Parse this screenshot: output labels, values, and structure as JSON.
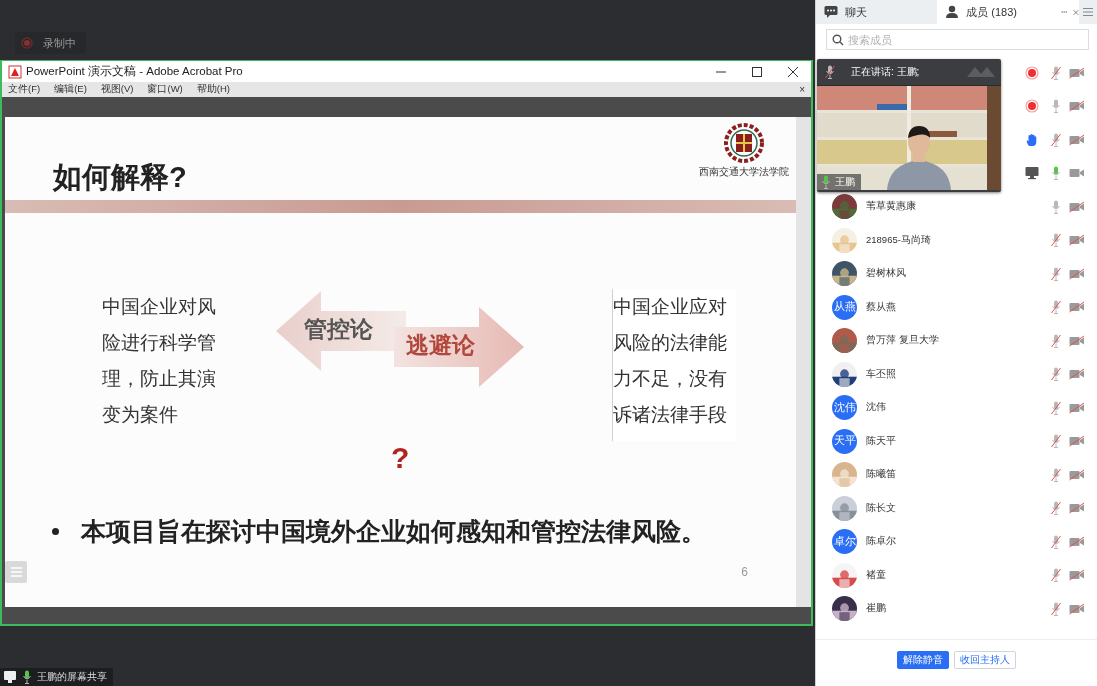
{
  "recording_badge": {
    "label": "录制中"
  },
  "shared_window": {
    "title": "PowerPoint 演示文稿 - Adobe Acrobat Pro",
    "menu": [
      "文件(F)",
      "编辑(E)",
      "视图(V)",
      "窗口(W)",
      "帮助(H)"
    ],
    "menu_close": "×",
    "slide": {
      "title": "如何解释?",
      "logo_text": "西南交通大学法学院",
      "left_text": "中国企业对风险进行科学管理，防止其演变为案件",
      "left_arrow": "管控论",
      "right_arrow": "逃避论",
      "right_text": "中国企业应对风险的法律能力不足，没有诉诸法律手段",
      "question_mark": "?",
      "bullet": "本项目旨在探讨中国境外企业如何感知和管控法律风险。",
      "page_number": "6"
    }
  },
  "share_label": {
    "text": "王鹏的屏幕共享"
  },
  "panel": {
    "tabs": [
      {
        "label": "聊天",
        "selected": false
      },
      {
        "label": "成员 (183)",
        "selected": true
      }
    ],
    "search": {
      "placeholder": "搜索成员"
    },
    "speaker": {
      "header": "正在讲话: 王鹏;",
      "name": "王鹏"
    },
    "members": [
      {
        "recording": true,
        "hand_raised": false,
        "sharing_screen": false,
        "muted": true,
        "speaking": false,
        "camera_on": false
      },
      {
        "recording": true,
        "hand_raised": false,
        "sharing_screen": false,
        "muted": false,
        "speaking": false,
        "camera_on": false
      },
      {
        "recording": false,
        "hand_raised": true,
        "sharing_screen": false,
        "muted": true,
        "speaking": false,
        "camera_on": false
      },
      {
        "recording": false,
        "hand_raised": false,
        "sharing_screen": true,
        "muted": false,
        "speaking": true,
        "camera_on": true
      },
      {
        "name": "苇草黄惠康",
        "muted": false,
        "speaking": false,
        "camera_on": false
      },
      {
        "name": "218965-马尚琦",
        "muted": true,
        "speaking": false,
        "camera_on": false
      },
      {
        "name": "碧树林风",
        "muted": true,
        "speaking": false,
        "camera_on": false
      },
      {
        "name": "蔡从燕",
        "avatar": {
          "kind": "initials",
          "text": "从燕"
        },
        "muted": true,
        "speaking": false,
        "camera_on": false
      },
      {
        "name": "曾万萍 复旦大学",
        "muted": true,
        "speaking": false,
        "camera_on": false
      },
      {
        "name": "车丕照",
        "muted": true,
        "speaking": false,
        "camera_on": false
      },
      {
        "name": "沈伟",
        "avatar": {
          "kind": "initials",
          "text": "沈伟"
        },
        "muted": true,
        "speaking": false,
        "camera_on": false
      },
      {
        "name": "陈天平",
        "avatar": {
          "kind": "initials",
          "text": "天平"
        },
        "muted": true,
        "speaking": false,
        "camera_on": false
      },
      {
        "name": "陈曦笛",
        "muted": true,
        "speaking": false,
        "camera_on": false
      },
      {
        "name": "陈长文",
        "muted": true,
        "speaking": false,
        "camera_on": false
      },
      {
        "name": "陈卓尔",
        "avatar": {
          "kind": "initials",
          "text": "卓尔"
        },
        "muted": true,
        "speaking": false,
        "camera_on": false
      },
      {
        "name": "褚童",
        "muted": true,
        "speaking": false,
        "camera_on": false
      },
      {
        "name": "崔鹏",
        "muted": true,
        "speaking": false,
        "camera_on": false
      }
    ],
    "buttons": [
      {
        "label": "解除静音",
        "primary": true
      },
      {
        "label": "收回主持人",
        "primary": false
      }
    ]
  }
}
